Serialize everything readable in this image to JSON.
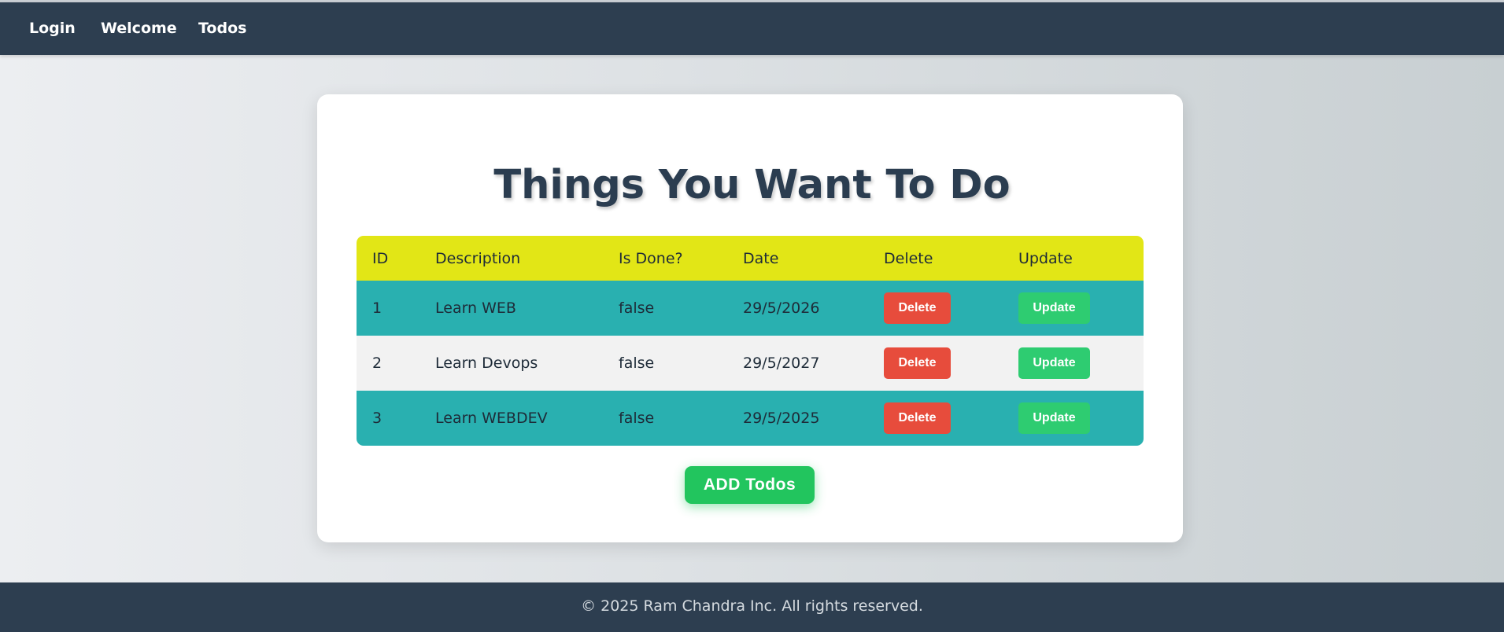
{
  "nav": {
    "items": [
      "Login",
      "Welcome",
      "Todos"
    ]
  },
  "main": {
    "title": "Things You Want To Do",
    "table": {
      "headers": [
        "ID",
        "Description",
        "Is Done?",
        "Date",
        "Delete",
        "Update"
      ],
      "rows": [
        {
          "id": "1",
          "description": "Learn WEB",
          "done": "false",
          "date": "29/5/2026",
          "delete_label": "Delete",
          "update_label": "Update"
        },
        {
          "id": "2",
          "description": "Learn Devops",
          "done": "false",
          "date": "29/5/2027",
          "delete_label": "Delete",
          "update_label": "Update"
        },
        {
          "id": "3",
          "description": "Learn WEBDEV",
          "done": "false",
          "date": "29/5/2025",
          "delete_label": "Delete",
          "update_label": "Update"
        }
      ]
    },
    "add_button_label": "ADD Todos"
  },
  "footer": {
    "text": "© 2025 Ram Chandra Inc. All rights reserved."
  },
  "colors": {
    "navbar_bg": "#2d3e50",
    "header_row_bg": "#e2e616",
    "teal_row_bg": "#29b0b0",
    "light_row_bg": "#f2f2f2",
    "delete_button": "#e74c3c",
    "update_button": "#2ecc71",
    "add_button": "#22c55e"
  }
}
